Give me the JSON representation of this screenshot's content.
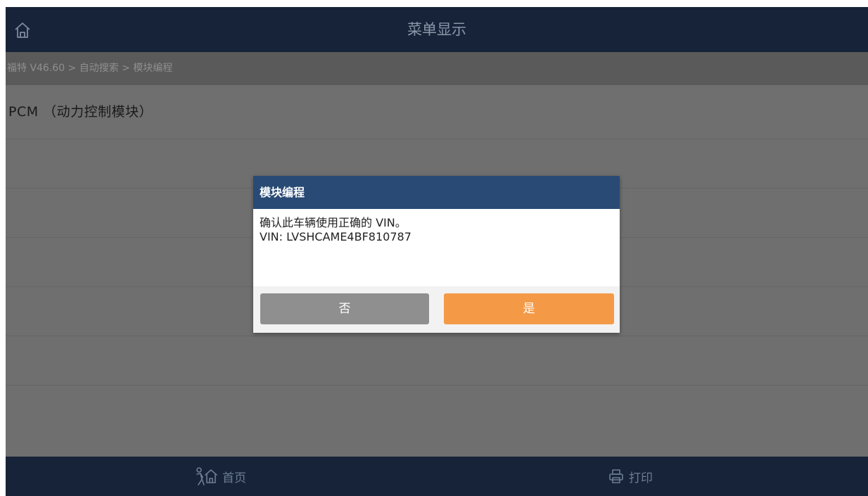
{
  "header": {
    "title": "菜单显示",
    "home_icon": "home-outline-icon"
  },
  "breadcrumb": "福特 V46.60 > 自动搜索 > 模块编程",
  "list": {
    "items": [
      {
        "label": "PCM （动力控制模块）"
      }
    ]
  },
  "dialog": {
    "title": "模块编程",
    "message_line1": "确认此车辆使用正确的 VIN。",
    "message_line2": "VIN: LVSHCAME4BF810787",
    "no_label": "否",
    "yes_label": "是"
  },
  "footer": {
    "home_label": "首页",
    "home_icon": "person-home-icon",
    "print_label": "打印",
    "print_icon": "printer-icon"
  },
  "colors": {
    "topbar": "#162338",
    "dialog_header": "#284a74",
    "yes_button": "#f49a47",
    "no_button": "#8f8f8f"
  }
}
